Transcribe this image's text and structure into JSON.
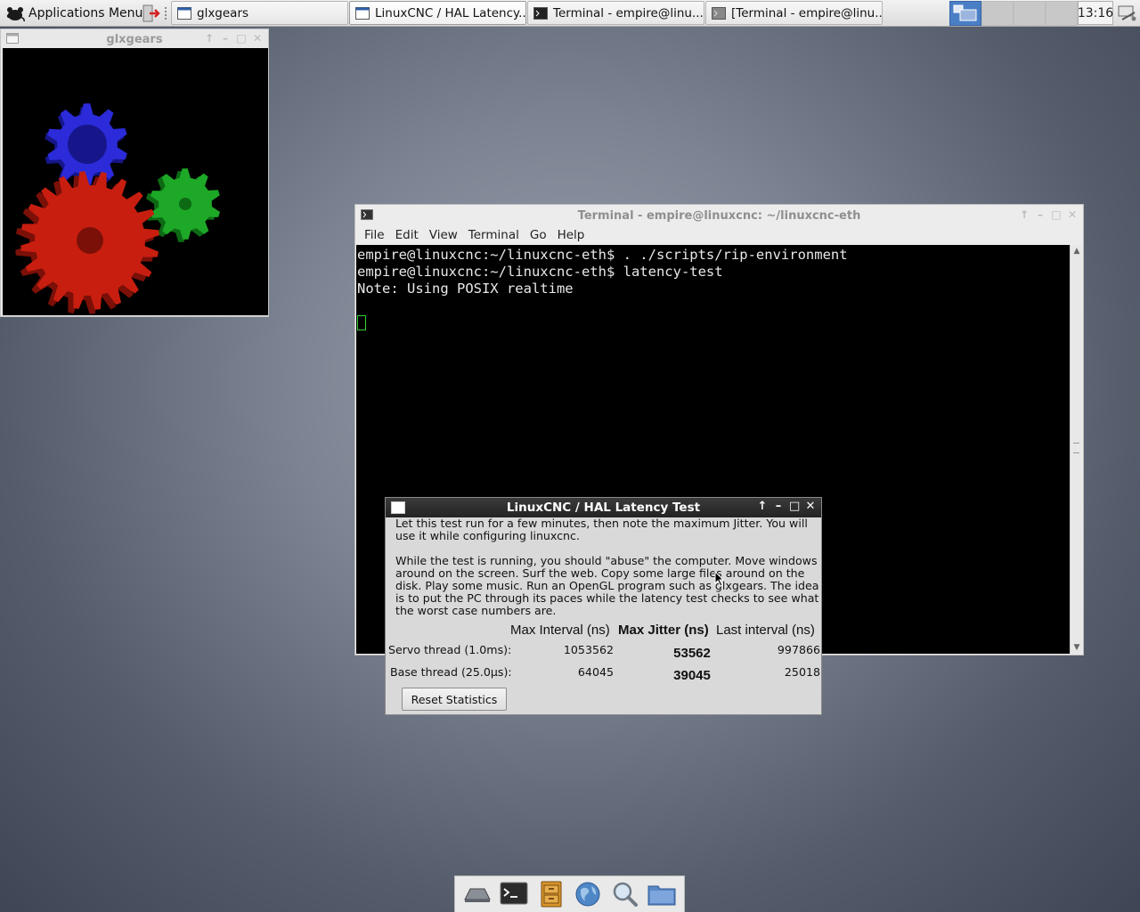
{
  "panel": {
    "apps_menu_label": "Applications Menu",
    "tasks": [
      {
        "label": "glxgears",
        "active": false
      },
      {
        "label": "LinuxCNC / HAL Latency...",
        "active": true
      },
      {
        "label": "Terminal - empire@linu...",
        "active": false
      },
      {
        "label": "[Terminal - empire@linu...",
        "active": false
      }
    ],
    "clock": "13:16"
  },
  "glxgears": {
    "title": "glxgears",
    "colors": {
      "blue_gear": "#2b2bd9",
      "red_gear": "#c81e10",
      "green_gear": "#1ea828"
    }
  },
  "terminal": {
    "title": "Terminal - empire@linuxcnc: ~/linuxcnc-eth",
    "menu": [
      "File",
      "Edit",
      "View",
      "Terminal",
      "Go",
      "Help"
    ],
    "lines": [
      "empire@linuxcnc:~/linuxcnc-eth$ . ./scripts/rip-environment",
      "empire@linuxcnc:~/linuxcnc-eth$ latency-test",
      "Note: Using POSIX realtime"
    ]
  },
  "latency": {
    "title": "LinuxCNC / HAL Latency Test",
    "para1": "Let this test run for a few minutes, then note the maximum Jitter.  You will use it while configuring linuxcnc.",
    "para2": "While the test is running, you should \"abuse\" the computer. Move windows around on the screen. Surf the web. Copy some large files around on the disk. Play some music. Run an OpenGL program such as glxgears. The idea is to put the PC through its paces while the latency test checks to see what the worst case numbers are.",
    "headers": {
      "max_interval": "Max Interval (ns)",
      "max_jitter": "Max Jitter (ns)",
      "last_interval": "Last interval (ns)"
    },
    "rows": [
      {
        "label": "Servo thread (1.0ms):",
        "max_interval": "1053562",
        "max_jitter": "53562",
        "last_interval": "997866"
      },
      {
        "label": "Base thread (25.0µs):",
        "max_interval": "64045",
        "max_jitter": "39045",
        "last_interval": "25018"
      }
    ],
    "reset_label": "Reset Statistics"
  },
  "dock": {
    "items": [
      "show-desktop-icon",
      "terminal-icon",
      "file-cabinet-icon",
      "web-browser-icon",
      "search-icon",
      "folder-icon"
    ]
  }
}
